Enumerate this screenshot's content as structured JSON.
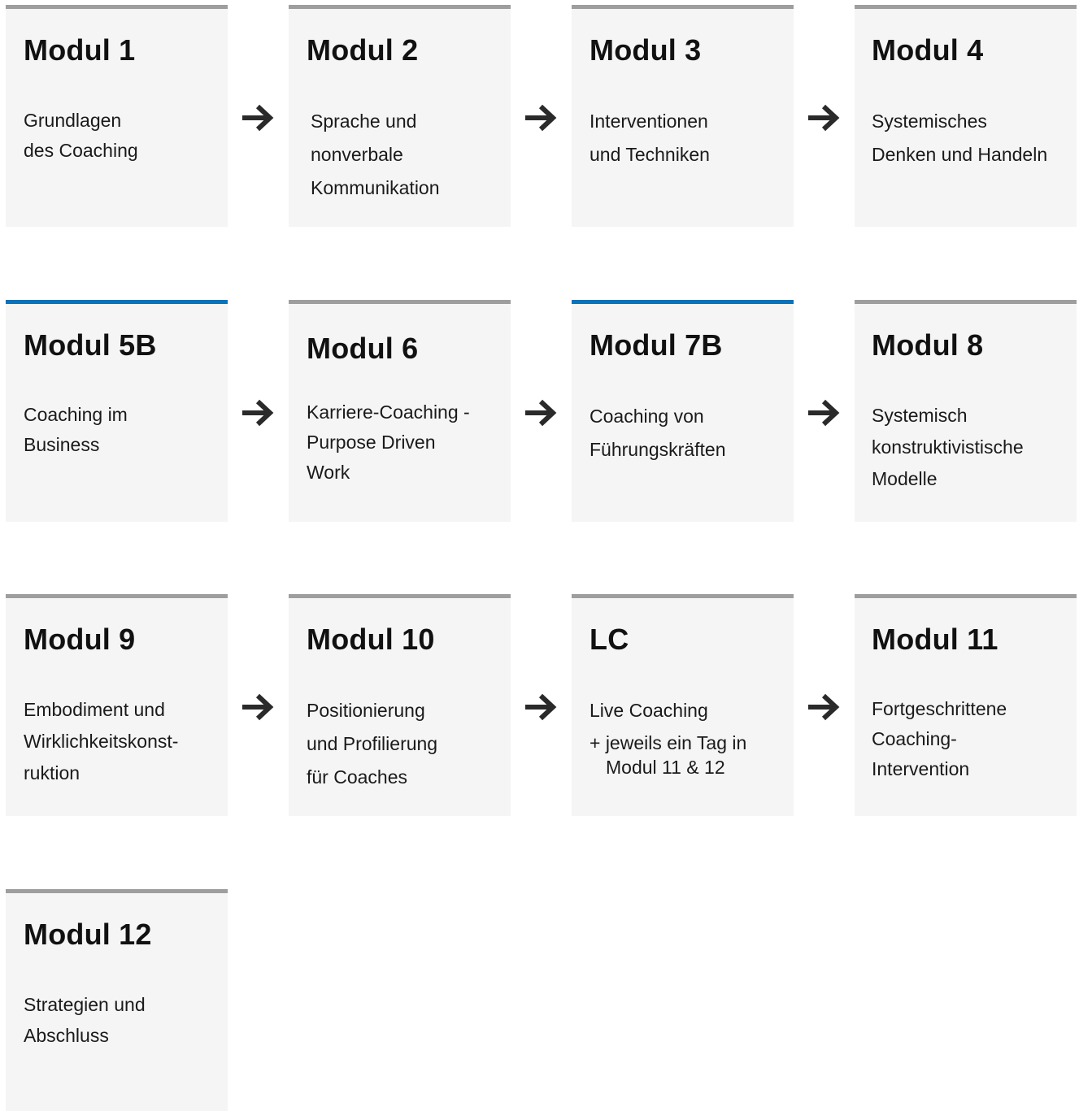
{
  "rows": [
    {
      "modules": [
        {
          "title": "Modul 1",
          "accent": false,
          "lines": [
            "Grundlagen",
            "des Coaching"
          ]
        },
        {
          "title": "Modul 2",
          "accent": false,
          "lines": [
            "Sprache und",
            "nonverbale",
            "Kommunikation"
          ]
        },
        {
          "title": "Modul 3",
          "accent": false,
          "lines": [
            "Interventionen",
            "und Techniken"
          ]
        },
        {
          "title": "Modul 4",
          "accent": false,
          "lines": [
            "Systemisches",
            "Denken und Handeln"
          ]
        }
      ]
    },
    {
      "modules": [
        {
          "title": "Modul 5B",
          "accent": true,
          "lines": [
            "Coaching im",
            "Business"
          ]
        },
        {
          "title": "Modul 6",
          "accent": false,
          "lines": [
            "Karriere-Coaching -",
            "Purpose Driven",
            "Work"
          ]
        },
        {
          "title": "Modul 7B",
          "accent": true,
          "lines": [
            "Coaching von",
            "Führungskräften"
          ]
        },
        {
          "title": "Modul 8",
          "accent": false,
          "lines": [
            "Systemisch",
            "konstruktivistische",
            "Modelle"
          ]
        }
      ]
    },
    {
      "modules": [
        {
          "title": "Modul 9",
          "accent": false,
          "lines": [
            "Embodiment und",
            "Wirklichkeitskonst-",
            "ruktion"
          ]
        },
        {
          "title": "Modul 10",
          "accent": false,
          "lines": [
            "Positionierung",
            "und Profilierung",
            "für Coaches"
          ]
        },
        {
          "title": "LC",
          "accent": false,
          "lines": [
            "Live Coaching",
            "+ jeweils ein Tag in",
            "Modul 11 & 12"
          ]
        },
        {
          "title": "Modul 11",
          "accent": false,
          "lines": [
            "Fortgeschrittene",
            "Coaching-",
            "Intervention"
          ]
        }
      ]
    },
    {
      "modules": [
        {
          "title": "Modul 12",
          "accent": false,
          "lines": [
            "Strategien und",
            "Abschluss"
          ]
        }
      ]
    }
  ],
  "colors": {
    "accent": "#0a72b8",
    "border": "#9e9e9e",
    "card_bg": "#f5f5f5",
    "arrow": "#2a2a2a"
  },
  "icons": {
    "connector": "arrow-right-icon"
  }
}
